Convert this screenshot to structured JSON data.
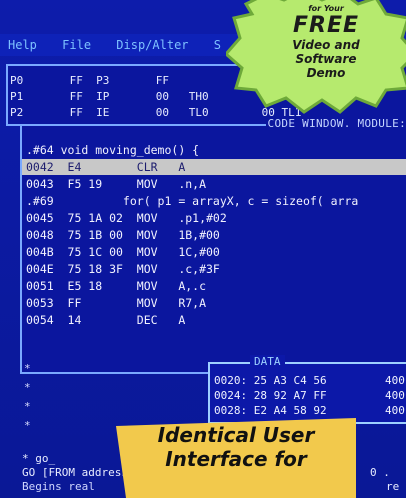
{
  "menu": {
    "items": [
      "Help",
      "File",
      "Disp/Alter",
      "S"
    ]
  },
  "registers": {
    "rows": [
      "P0       FF  P3       FF",
      "P1       FF  IP       00   TH0           TH1",
      "P2       FF  IE       00   TL0        00 TL1"
    ]
  },
  "code_window": {
    "title": "CODE WINDOW. MODULE:",
    "lines": [
      {
        "text": ".#64 void moving_demo() {",
        "selected": false
      },
      {
        "text": "0042  E4        CLR   A",
        "selected": true
      },
      {
        "text": "0043  F5 19     MOV   .n,A",
        "selected": false
      },
      {
        "text": ".#69          for( p1 = arrayX, c = sizeof( arra",
        "selected": false
      },
      {
        "text": "0045  75 1A 02  MOV   .p1,#02",
        "selected": false
      },
      {
        "text": "0048  75 1B 00  MOV   1B,#00",
        "selected": false
      },
      {
        "text": "004B  75 1C 00  MOV   1C,#00",
        "selected": false
      },
      {
        "text": "004E  75 18 3F  MOV   .c,#3F",
        "selected": false
      },
      {
        "text": "0051  E5 18     MOV   A,.c",
        "selected": false
      },
      {
        "text": "0053  FF        MOV   R7,A",
        "selected": false
      },
      {
        "text": "0054  14        DEC   A",
        "selected": false
      }
    ]
  },
  "data_window": {
    "title": "DATA",
    "rows": [
      {
        "left": "0020: 25 A3 C4 56",
        "right": "400"
      },
      {
        "left": "0024: 28 92 A7 FF",
        "right": "400"
      },
      {
        "left": "0028: E2 A4 58 92",
        "right": "400"
      }
    ]
  },
  "command": {
    "lines": [
      "* go_",
      "GO [FROM address]",
      "Begins real"
    ],
    "tail1": "0 .",
    "tail2": "re"
  },
  "promo": {
    "badge_small": "for Your",
    "badge_free": "FREE",
    "badge_line1": "Video and",
    "badge_line2": "Software Demo",
    "banner_line1": "Identical User",
    "banner_line2": "Interface for"
  },
  "colors": {
    "background": "#0c1aa3",
    "accent_green": "#a9e26a",
    "banner_yellow": "#f2c94c"
  }
}
